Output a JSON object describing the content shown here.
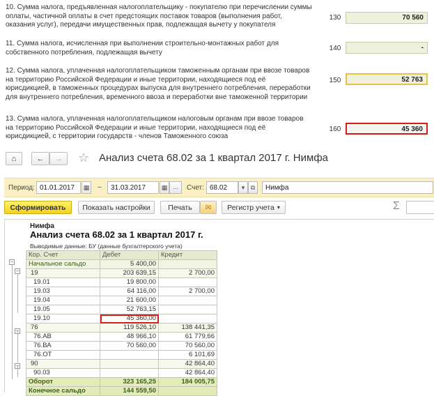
{
  "declaration": {
    "items": [
      {
        "text": "10. Сумма налога, предъявленная налогоплательщику - покупателю при перечислении суммы оплаты, частичной оплаты в счет предстоящих поставок товаров (выполнения работ, оказания услуг), передачи имущественных прав, подлежащая вычету у покупателя",
        "code": "130",
        "value": "70 560",
        "style": "normal"
      },
      {
        "text": "11. Сумма налога, исчисленная при выполнении строительно-монтажных работ для собственного потребления, подлежащая вычету",
        "code": "140",
        "value": "-",
        "style": "normal"
      },
      {
        "text": "12. Сумма налога, уплаченная налогоплательщиком таможенным органам при ввозе товаров на территорию Российской Федерации и иные территории, находящиеся под её юрисдикцией, в таможенных процедурах выпуска для внутреннего потребления, переработки для внутреннего потребления, временного ввоза и переработки вне таможенной территории",
        "code": "150",
        "value": "52 763",
        "style": "yellow"
      },
      {
        "text": "13. Сумма налога, уплаченная налогоплательщиком налоговым органам при ввозе товаров на территорию Российской Федерации и иные территории, находящиеся под её юрисдикцией, с территории государств - членов Таможенного союза",
        "code": "160",
        "value": "45 360",
        "style": "red"
      }
    ]
  },
  "window": {
    "title": "Анализ счета 68.02 за 1 квартал 2017 г. Нимфа",
    "home_icon": "⌂",
    "back_icon": "←",
    "forward_icon": "→",
    "star_icon": "☆"
  },
  "params": {
    "period_label": "Период:",
    "date_from": "01.01.2017",
    "dash": "–",
    "date_to": "31.03.2017",
    "ellipsis": "...",
    "account_label": "Счет:",
    "account": "68.02",
    "organization": "Нимфа"
  },
  "toolbar": {
    "generate": "Сформировать",
    "settings": "Показать настройки",
    "print": "Печать",
    "register": "Регистр учета",
    "sigma": "Σ"
  },
  "report": {
    "org": "Нимфа",
    "title": "Анализ счета 68.02 за 1 квартал 2017 г.",
    "subtitle": "Выводимые данные:  БУ (данные бухгалтерского учета)",
    "headers": [
      "Кор. Счет",
      "Дебет",
      "Кредит"
    ],
    "rows": [
      {
        "account": "Начальное сальдо",
        "debit": "5 400,00",
        "credit": "",
        "kind": "grp"
      },
      {
        "account": "19",
        "debit": "203 639,15",
        "credit": "2 700,00",
        "kind": "lvl1"
      },
      {
        "account": "19.01",
        "debit": "19 800,00",
        "credit": "",
        "kind": "lvl2"
      },
      {
        "account": "19.03",
        "debit": "64 116,00",
        "credit": "2 700,00",
        "kind": "lvl2"
      },
      {
        "account": "19.04",
        "debit": "21 600,00",
        "credit": "",
        "kind": "lvl2"
      },
      {
        "account": "19.05",
        "debit": "52 763,15",
        "credit": "",
        "kind": "lvl2"
      },
      {
        "account": "19.10",
        "debit": "45 360,00",
        "credit": "",
        "kind": "lvl2",
        "highlight": true
      },
      {
        "account": "76",
        "debit": "119 526,10",
        "credit": "138 441,35",
        "kind": "lvl1"
      },
      {
        "account": "76.АВ",
        "debit": "48 966,10",
        "credit": "61 779,66",
        "kind": "lvl2"
      },
      {
        "account": "76.ВА",
        "debit": "70 560,00",
        "credit": "70 560,00",
        "kind": "lvl2"
      },
      {
        "account": "76.ОТ",
        "debit": "",
        "credit": "6 101,69",
        "kind": "lvl2"
      },
      {
        "account": "90",
        "debit": "",
        "credit": "42 864,40",
        "kind": "lvl1"
      },
      {
        "account": "90.03",
        "debit": "",
        "credit": "42 864,40",
        "kind": "lvl2"
      },
      {
        "account": "Оборот",
        "debit": "323 165,25",
        "credit": "184 005,75",
        "kind": "tot"
      },
      {
        "account": "Конечное сальдо",
        "debit": "144 559,50",
        "credit": "",
        "kind": "tot"
      }
    ]
  },
  "colors": {
    "accent_yellow": "#f2d21b",
    "highlight_red": "#d61b1b",
    "params_bg": "#fbf0c4",
    "table_header": "#e7e9cf",
    "total_row": "#e3ebb8"
  }
}
